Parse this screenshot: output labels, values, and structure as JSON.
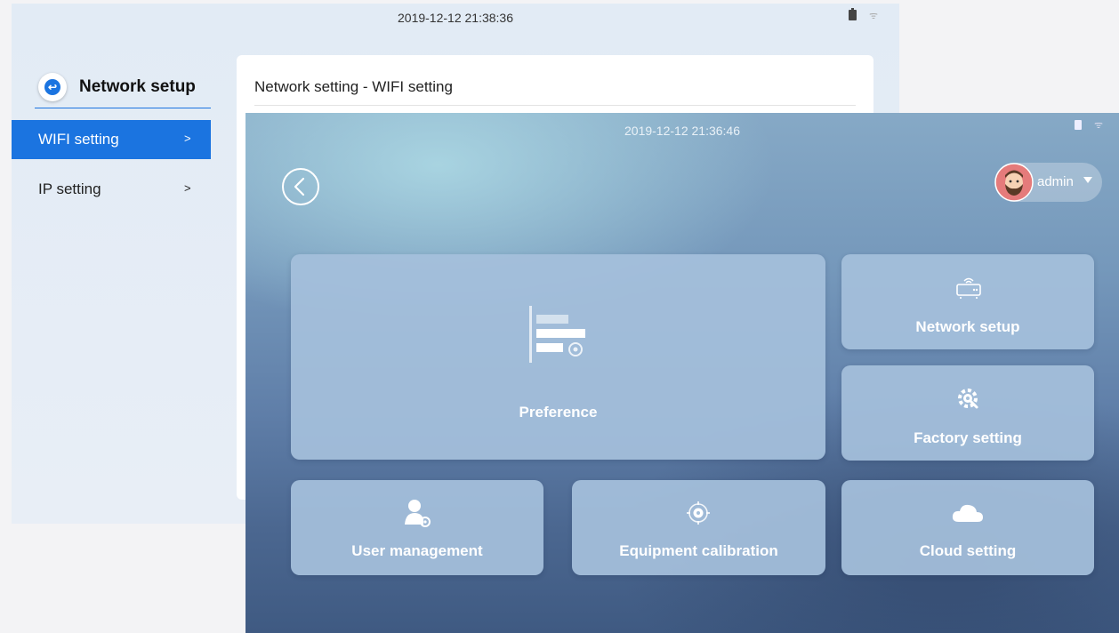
{
  "back_window": {
    "status_time": "2019-12-12 21:38:36",
    "title": "Network setup",
    "sidebar": {
      "items": [
        {
          "label": "WIFI setting",
          "arrow": ">",
          "selected": true
        },
        {
          "label": "IP setting",
          "arrow": ">",
          "selected": false
        }
      ]
    },
    "panel_title": "Network setting - WIFI setting"
  },
  "front_window": {
    "status_time": "2019-12-12 21:36:46",
    "user": {
      "name": "admin"
    },
    "tiles": {
      "preference": "Preference",
      "network_setup": "Network setup",
      "factory_setting": "Factory setting",
      "user_management": "User management",
      "equipment_calibration": "Equipment calibration",
      "cloud_setting": "Cloud setting"
    }
  },
  "colors": {
    "accent": "#1b74e0",
    "tile": "#a5c0db",
    "avatar_bg": "#e57b7b"
  }
}
